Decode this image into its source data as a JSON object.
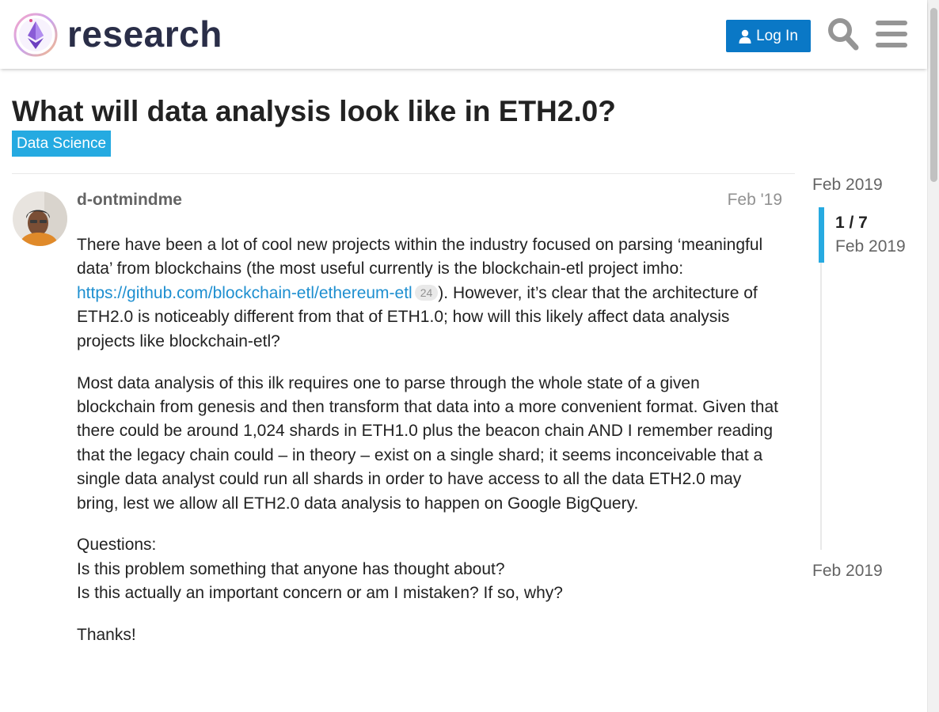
{
  "header": {
    "logo_text": "research",
    "login_label": "Log In",
    "search_icon": "search-icon",
    "menu_icon": "hamburger-menu-icon",
    "accent_color": "#0a78c6"
  },
  "topic": {
    "title": "What will data analysis look like in ETH2.0?",
    "category": "Data Science",
    "category_color": "#25aae1"
  },
  "post": {
    "author": "d-ontmindme",
    "date": "Feb '19",
    "p1_before": "There have been a lot of cool new projects within the industry focused on parsing ‘meaningful data’ from blockchains (the most useful currently is the blockchain-etl project imho: ",
    "link_text": "https://github.com/blockchain-etl/ethereum-etl",
    "link_clicks": "24",
    "p1_after": "). However, it’s clear that the architecture of ETH2.0 is noticeably different from that of ETH1.0; how will this likely affect data analysis projects like blockchain-etl?",
    "p2": "Most data analysis of this ilk requires one to parse through the whole state of a given blockchain from genesis and then transform that data into a more convenient format. Given that there could be around 1,024 shards in ETH1.0 plus the beacon chain AND I remember reading that the legacy chain could – in theory – exist on a single shard; it seems inconceivable that a single data analyst could run all shards in order to have access to all the data ETH2.0 may bring, lest we allow all ETH2.0 data analysis to happen on Google BigQuery.",
    "p3_line1": "Questions:",
    "p3_line2": "Is this problem something that anyone has thought about?",
    "p3_line3": "Is this actually an important concern or am I mistaken? If so, why?",
    "p4": "Thanks!"
  },
  "timeline": {
    "start_date": "Feb 2019",
    "position": "1 / 7",
    "position_date": "Feb 2019",
    "end_date": "Feb 2019"
  }
}
